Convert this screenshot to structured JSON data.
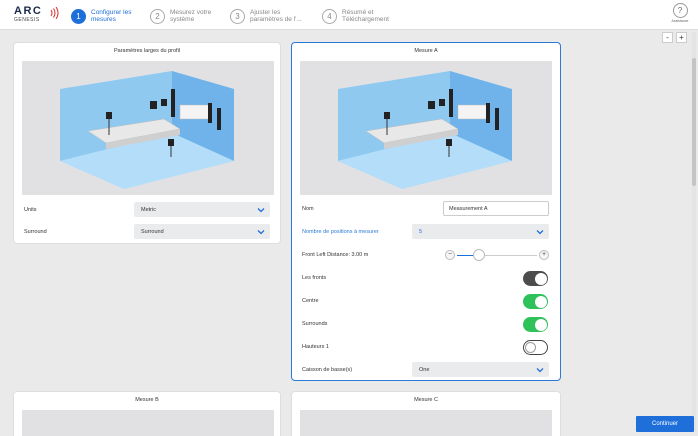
{
  "app": {
    "logo_text": "ARC",
    "logo_sub": "GENESIS",
    "assistance_label": "Assistance",
    "accent_color": "#1e6fd9",
    "toggle_on_color": "#2fc15a"
  },
  "steps": [
    {
      "num": "1",
      "label": "Configurer les mesures",
      "active": true
    },
    {
      "num": "2",
      "label": "Mesurez votre système",
      "active": false
    },
    {
      "num": "3",
      "label": "Ajuster les paramètres de l'...",
      "active": false
    },
    {
      "num": "4",
      "label": "Résumé et Téléchargement",
      "active": false
    }
  ],
  "zoom": {
    "minus": "-",
    "plus": "+"
  },
  "profile_card": {
    "title": "Paramètres larges du profil",
    "units_label": "Units",
    "units_value": "Metric",
    "surround_label": "Surround",
    "surround_value": "Surround"
  },
  "measure_a": {
    "title": "Mesure A",
    "name_label": "Nom",
    "name_value": "Measurement A",
    "positions_label": "Nombre de positions à mesurer",
    "positions_value": "5",
    "distance_label": "Front Left Distance: 3.00 m",
    "distance_fraction": 0.28,
    "fronts_label": "Les fronts",
    "fronts_state": "on-dark",
    "centre_label": "Centre",
    "centre_state": "on",
    "surrounds_label": "Surrounds",
    "surrounds_state": "on",
    "heights_label": "Hauteurs 1",
    "heights_state": "off",
    "sub_label": "Caisson de basse(s)",
    "sub_value": "One"
  },
  "measure_b": {
    "title": "Mesure B"
  },
  "measure_c": {
    "title": "Mesure C"
  },
  "footer": {
    "continue_label": "Continuer"
  }
}
